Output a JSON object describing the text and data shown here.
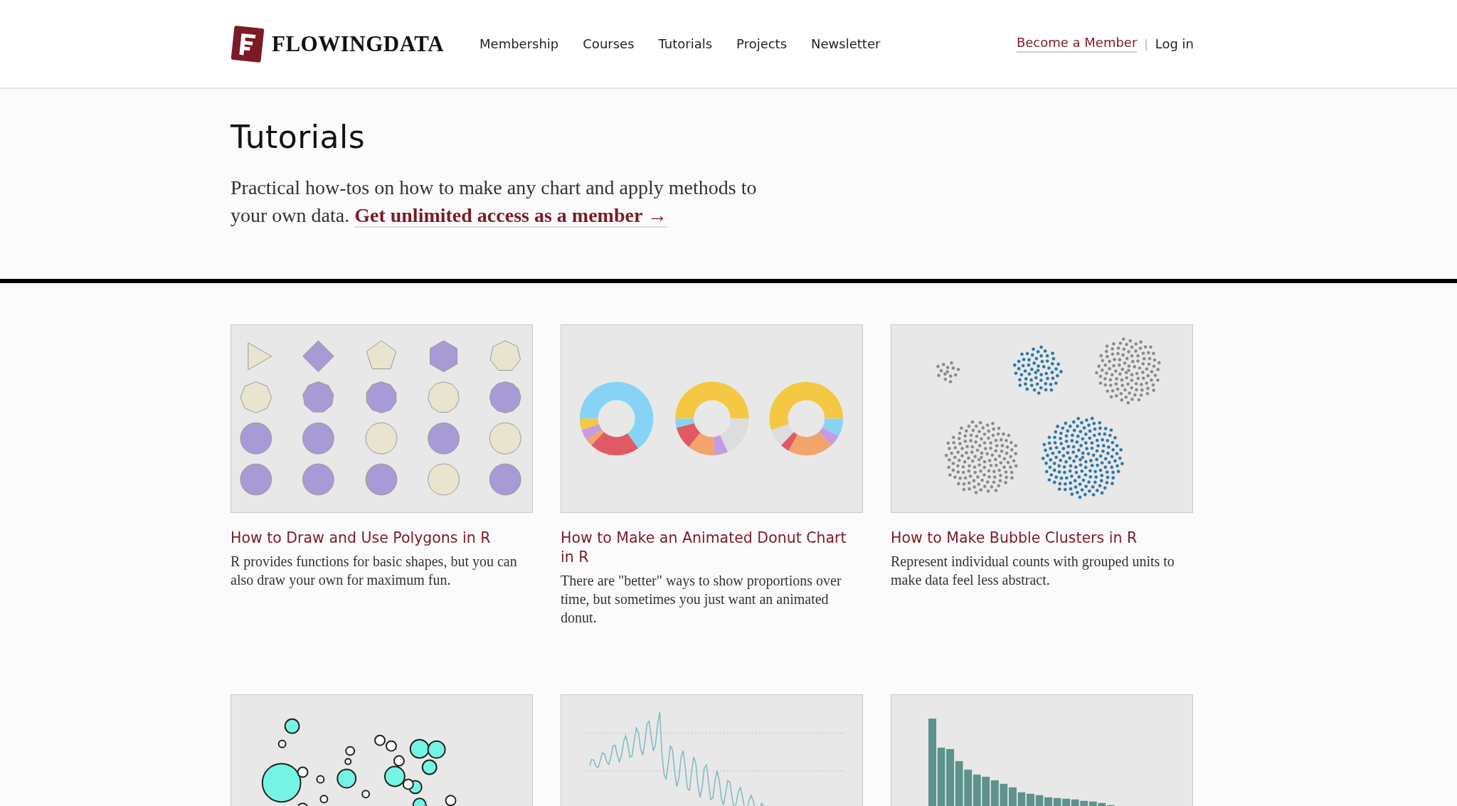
{
  "header": {
    "logo_text": "FLOWINGDATA",
    "nav": [
      {
        "label": "Membership"
      },
      {
        "label": "Courses"
      },
      {
        "label": "Tutorials"
      },
      {
        "label": "Projects"
      },
      {
        "label": "Newsletter"
      }
    ],
    "become_member": "Become a Member",
    "separator": "|",
    "login": "Log in"
  },
  "page": {
    "title": "Tutorials",
    "intro": "Practical how-tos on how to make any chart and apply methods to your own data.",
    "intro_link": "Get unlimited access as a member →"
  },
  "cards": [
    {
      "kind": "polygons",
      "title": "How to Draw and Use Polygons in R",
      "description": "R provides functions for basic shapes, but you can also draw your own for maximum fun."
    },
    {
      "kind": "donuts",
      "title": "How to Make an Animated Donut Chart in R",
      "description": "There are \"better\" ways to show proportions over time, but sometimes you just want an animated donut."
    },
    {
      "kind": "bubbles",
      "title": "How to Make Bubble Clusters in R",
      "description": "Represent individual counts with grouped units to make data feel less abstract."
    },
    {
      "kind": "map"
    },
    {
      "kind": "line"
    },
    {
      "kind": "bars"
    }
  ]
}
